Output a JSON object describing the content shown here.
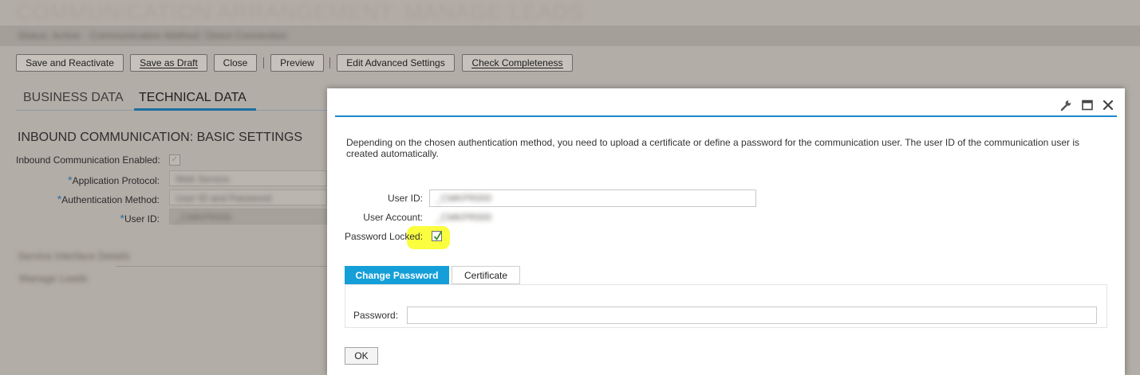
{
  "page": {
    "title": "COMMUNICATION ARRANGEMENT: MANAGE LEADS",
    "subtitle": "Status: Active  ·  Communication Method: Direct Connection"
  },
  "toolbar": {
    "save_reactivate": "Save and Reactivate",
    "save_draft": "Save as Draft",
    "close": "Close",
    "preview": "Preview",
    "edit_advanced": "Edit Advanced Settings",
    "check_completeness": "Check Completeness"
  },
  "tabs": {
    "business": "BUSINESS DATA",
    "technical": "TECHNICAL DATA"
  },
  "inbound": {
    "section_title": "INBOUND COMMUNICATION: BASIC SETTINGS",
    "enabled_label": "Inbound Communication Enabled:",
    "protocol_label": "Application Protocol:",
    "protocol_value": "Web Service",
    "auth_label": "Authentication Method:",
    "auth_value": "User ID and Password",
    "userid_label": "User ID:",
    "userid_value": "_CMKPR000",
    "service_label": "Service Interface Details",
    "service_value": "Manage Leads",
    "required_marker": "*"
  },
  "dialog": {
    "description": "Depending on the chosen authentication method, you need to upload a certificate or define a password for the communication user. The user ID of the communication user is created automatically.",
    "user_id_label": "User ID:",
    "user_id_value": "_CMKPR000",
    "user_account_label": "User Account:",
    "user_account_value": "_CMKPR000",
    "password_locked_label": "Password Locked:",
    "tab_change_password": "Change Password",
    "tab_certificate": "Certificate",
    "password_label": "Password:",
    "password_value": "",
    "ok_label": "OK"
  },
  "icons": [
    "wrench-icon",
    "maximize-icon",
    "close-icon",
    "checkmark-icon"
  ],
  "colors": {
    "accent": "#149fd8",
    "highlight": "#fafe3e",
    "overlay_bg": "#b3ada7"
  }
}
